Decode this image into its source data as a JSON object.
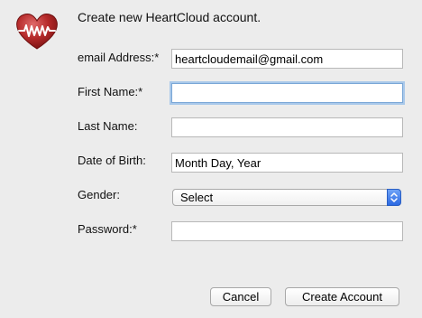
{
  "header": {
    "title": "Create new HeartCloud account.",
    "logo_icon": "heartbeat-heart-icon",
    "logo_color": "#b52a2a"
  },
  "form": {
    "email": {
      "label": "email Address:*",
      "value": "heartcloudemail@gmail.com"
    },
    "first_name": {
      "label": "First Name:*",
      "value": ""
    },
    "last_name": {
      "label": "Last Name:",
      "value": ""
    },
    "dob": {
      "label": "Date of Birth:",
      "value": "Month Day, Year"
    },
    "gender": {
      "label": "Gender:",
      "selected": "Select"
    },
    "password": {
      "label": "Password:*",
      "value": ""
    }
  },
  "buttons": {
    "cancel": "Cancel",
    "create": "Create Account"
  },
  "colors": {
    "focus_ring": "#a9c8ea",
    "select_stepper": "#2b69e2"
  }
}
